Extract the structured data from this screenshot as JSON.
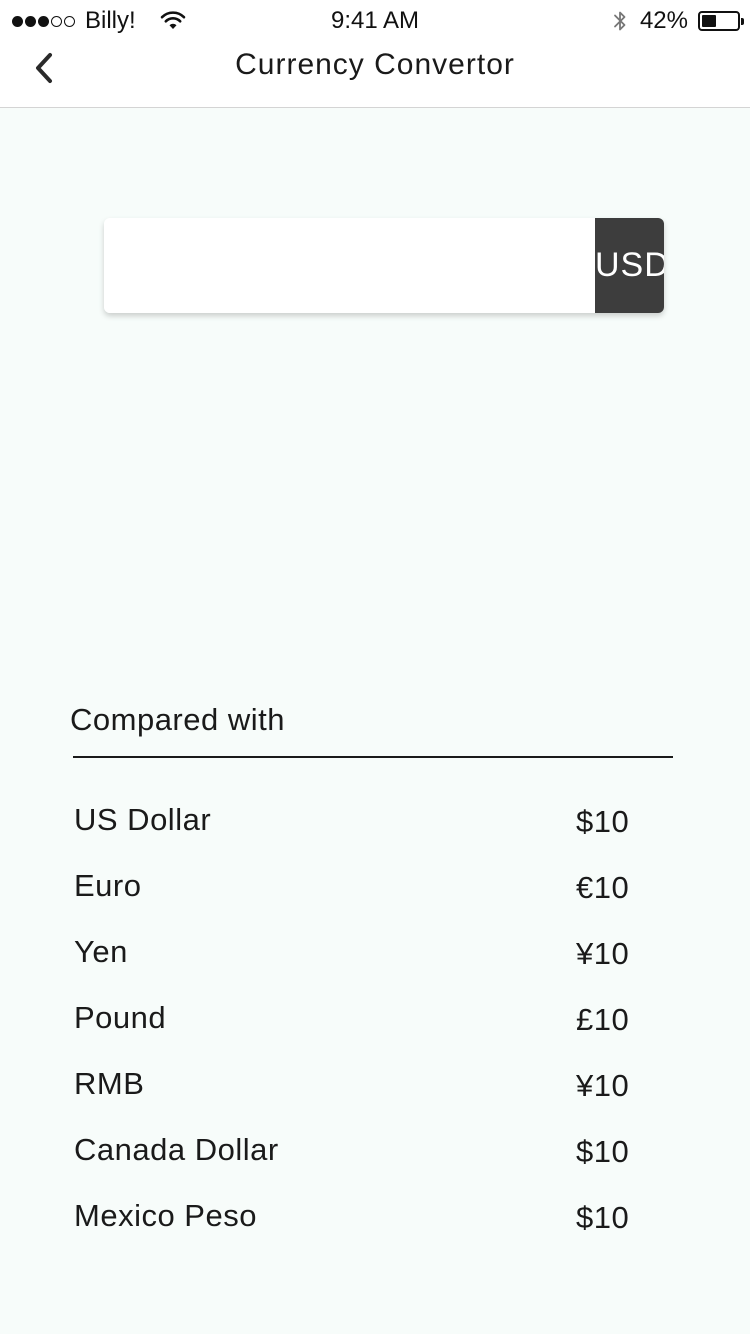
{
  "status_bar": {
    "carrier": "Billy!",
    "time": "9:41 AM",
    "battery_percent": "42%",
    "battery_level": 0.42,
    "signal_bars_filled": 3,
    "signal_bars_total": 5,
    "icons": [
      "wifi-icon",
      "bluetooth-icon",
      "battery-icon"
    ]
  },
  "nav": {
    "title": "Currency Convertor",
    "back_icon": "chevron-left-icon"
  },
  "converter": {
    "amount_value": "",
    "amount_placeholder": "",
    "currency": "USD",
    "dropdown_icon": "chevron-down-icon"
  },
  "comparison": {
    "heading": "Compared with",
    "rows": [
      {
        "name": "US Dollar",
        "value": "$10"
      },
      {
        "name": "Euro",
        "value": "€10"
      },
      {
        "name": "Yen",
        "value": "¥10"
      },
      {
        "name": "Pound",
        "value": "£10"
      },
      {
        "name": "RMB",
        "value": "¥10"
      },
      {
        "name": "Canada Dollar",
        "value": "$10"
      },
      {
        "name": "Mexico Peso",
        "value": "$10"
      }
    ]
  },
  "colors": {
    "background": "#f7fcfa",
    "header_background": "#ffffff",
    "dropdown_background": "#3d3d3d",
    "text": "#1a1a1a"
  }
}
